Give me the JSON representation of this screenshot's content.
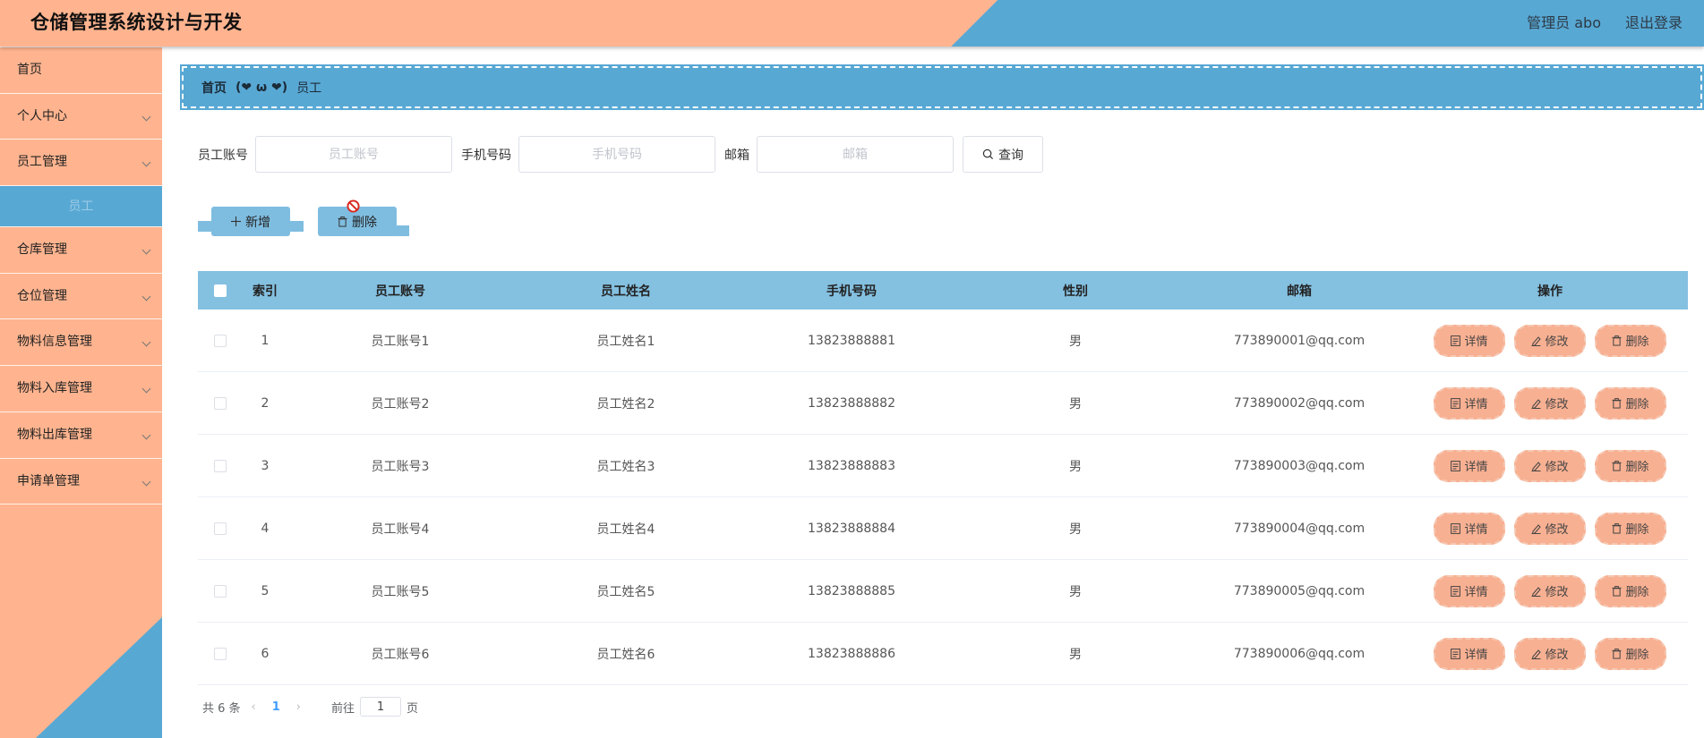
{
  "app": {
    "title": "仓储管理系统设计与开发",
    "user_label": "管理员 abo",
    "logout_label": "退出登录"
  },
  "colors": {
    "accent_orange": "#ffb48f",
    "accent_blue": "#58a8d4",
    "table_header": "#84c0e0",
    "op_button": "#f8b092"
  },
  "sidebar": {
    "items": [
      {
        "label": "首页",
        "has_children": false
      },
      {
        "label": "个人中心",
        "has_children": true
      },
      {
        "label": "员工管理",
        "has_children": true
      },
      {
        "label": "员工",
        "is_sub": true,
        "active": true
      },
      {
        "label": "仓库管理",
        "has_children": true
      },
      {
        "label": "仓位管理",
        "has_children": true
      },
      {
        "label": "物料信息管理",
        "has_children": true
      },
      {
        "label": "物料入库管理",
        "has_children": true
      },
      {
        "label": "物料出库管理",
        "has_children": true
      },
      {
        "label": "申请单管理",
        "has_children": true
      }
    ]
  },
  "breadcrumb": {
    "home": "首页",
    "separator": "(❤ ω ❤)",
    "current": "员工"
  },
  "search": {
    "account": {
      "label": "员工账号",
      "placeholder": "员工账号",
      "value": ""
    },
    "phone": {
      "label": "手机号码",
      "placeholder": "手机号码",
      "value": ""
    },
    "email": {
      "label": "邮箱",
      "placeholder": "邮箱",
      "value": ""
    },
    "query_label": "查询"
  },
  "actions": {
    "add_label": "新增",
    "delete_label": "删除"
  },
  "table": {
    "headers": {
      "index": "索引",
      "account": "员工账号",
      "name": "员工姓名",
      "phone": "手机号码",
      "gender": "性别",
      "email": "邮箱",
      "ops": "操作"
    },
    "ops": {
      "detail": "详情",
      "edit": "修改",
      "delete": "删除"
    },
    "rows": [
      {
        "index": "1",
        "account": "员工账号1",
        "name": "员工姓名1",
        "phone": "13823888881",
        "gender": "男",
        "email": "773890001@qq.com"
      },
      {
        "index": "2",
        "account": "员工账号2",
        "name": "员工姓名2",
        "phone": "13823888882",
        "gender": "男",
        "email": "773890002@qq.com"
      },
      {
        "index": "3",
        "account": "员工账号3",
        "name": "员工姓名3",
        "phone": "13823888883",
        "gender": "男",
        "email": "773890003@qq.com"
      },
      {
        "index": "4",
        "account": "员工账号4",
        "name": "员工姓名4",
        "phone": "13823888884",
        "gender": "男",
        "email": "773890004@qq.com"
      },
      {
        "index": "5",
        "account": "员工账号5",
        "name": "员工姓名5",
        "phone": "13823888885",
        "gender": "男",
        "email": "773890005@qq.com"
      },
      {
        "index": "6",
        "account": "员工账号6",
        "name": "员工姓名6",
        "phone": "13823888886",
        "gender": "男",
        "email": "773890006@qq.com"
      }
    ]
  },
  "pagination": {
    "total_text": "共 6 条",
    "current_page": "1",
    "goto_label": "前往",
    "goto_value": "1",
    "page_suffix": "页"
  }
}
